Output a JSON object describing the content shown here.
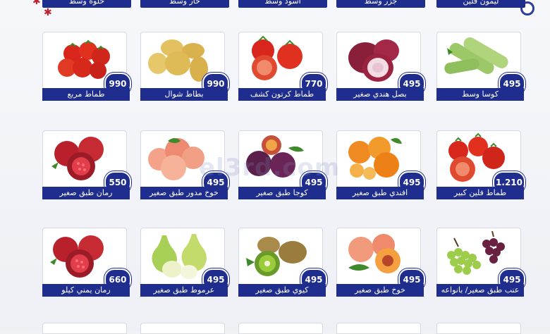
{
  "watermark": "el3rd.com",
  "top_row": [
    {
      "label": "ليمون فلين"
    },
    {
      "label": "جزر وسط"
    },
    {
      "label": "اسود وسط"
    },
    {
      "label": "خار وسط"
    },
    {
      "label": "حلوة وسط"
    }
  ],
  "products": [
    {
      "name": "طماط مربع",
      "price": "990",
      "icon": "tomato-icon"
    },
    {
      "name": "بطاط شوال",
      "price": "990",
      "icon": "potato-icon"
    },
    {
      "name": "طماط كرتون كشف",
      "price": "770",
      "icon": "tomato-cut-icon"
    },
    {
      "name": "بصل هندي صغير",
      "price": "495",
      "icon": "red-onion-icon"
    },
    {
      "name": "كوسا وسط",
      "price": "495",
      "icon": "zucchini-icon"
    },
    {
      "name": "رمان طبق صغير",
      "price": "550",
      "icon": "pomegranate-icon"
    },
    {
      "name": "خوخ مدور طبق صغير",
      "price": "495",
      "icon": "peach-icon"
    },
    {
      "name": "كوجا طبق صغير",
      "price": "495",
      "icon": "plum-icon"
    },
    {
      "name": "افندي طبق صغير",
      "price": "495",
      "icon": "tangerine-icon"
    },
    {
      "name": "طماط فلين كبير",
      "price": "1.210",
      "icon": "tomato-vine-icon"
    },
    {
      "name": "رمان يمني كيلو",
      "price": "660",
      "icon": "pomegranate-icon"
    },
    {
      "name": "عرموط طبق صغير",
      "price": "495",
      "icon": "pear-icon"
    },
    {
      "name": "كيوي طبق صغير",
      "price": "495",
      "icon": "kiwi-icon"
    },
    {
      "name": "خوخ طبق صغير",
      "price": "495",
      "icon": "peach-icon"
    },
    {
      "name": "عنب طبق صغير/ بانواعه",
      "price": "495",
      "icon": "grapes-icon"
    }
  ],
  "colors": {
    "bar": "#1f2d8f",
    "accent": "#c01f2e"
  }
}
